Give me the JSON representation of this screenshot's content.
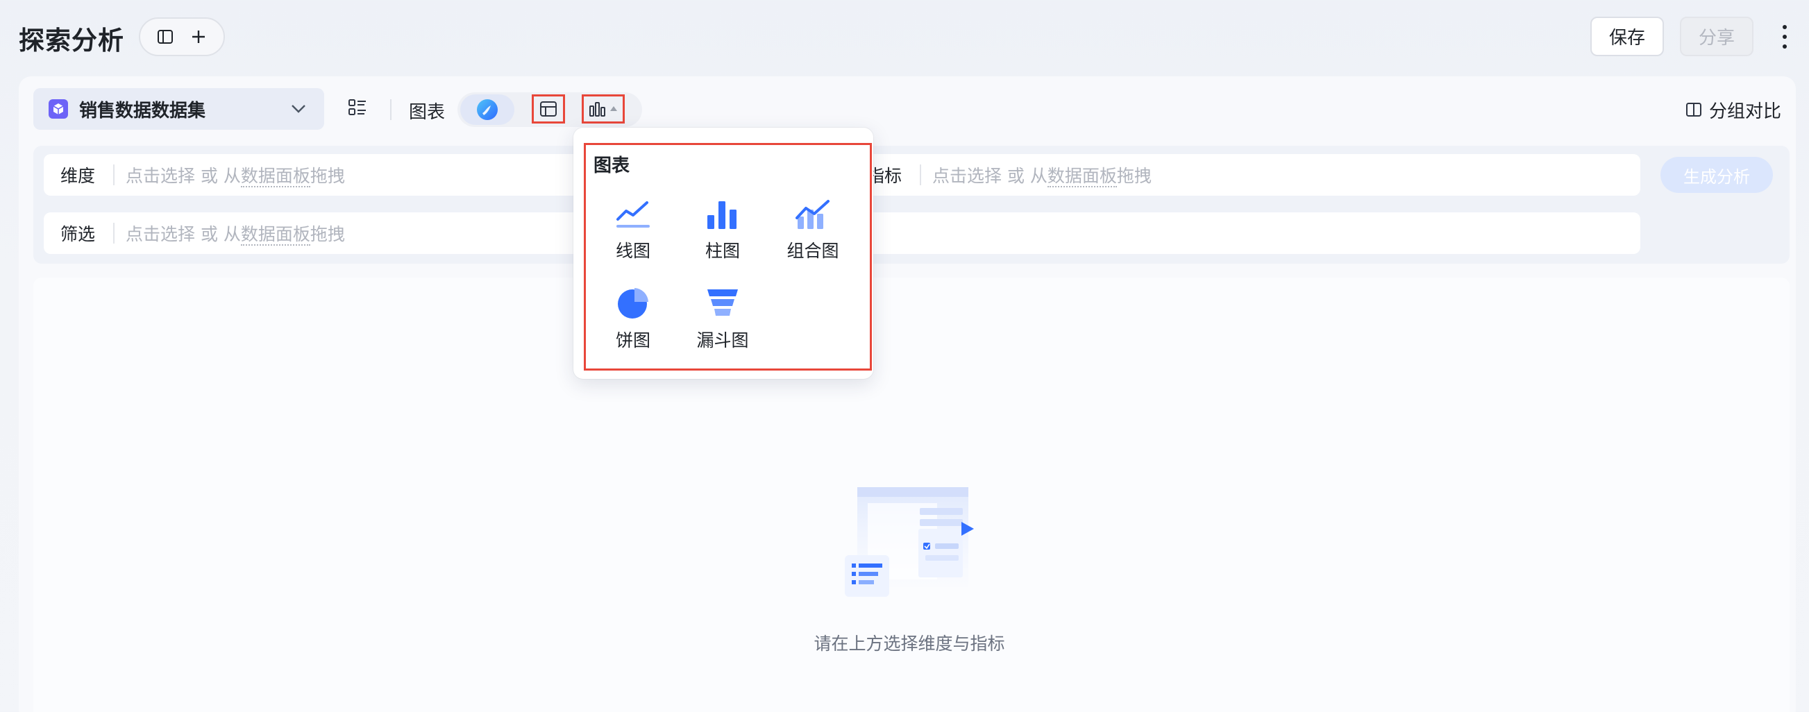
{
  "header": {
    "title": "探索分析",
    "save_label": "保存",
    "share_label": "分享"
  },
  "toolbar": {
    "dataset": "销售数据数据集",
    "chart_label": "图表",
    "group_compare": "分组对比"
  },
  "query": {
    "dimension_label": "维度",
    "metric_label": "指标",
    "filter_label": "筛选",
    "placeholder_prefix": "点击选择 或 从",
    "placeholder_link": "数据面板",
    "placeholder_suffix": "拖拽",
    "generate_label": "生成分析"
  },
  "empty_state": {
    "text": "请在上方选择维度与指标"
  },
  "chart_menu": {
    "title": "图表",
    "options": [
      {
        "label": "线图",
        "icon": "line-chart-icon"
      },
      {
        "label": "柱图",
        "icon": "bar-chart-icon"
      },
      {
        "label": "组合图",
        "icon": "combo-chart-icon"
      },
      {
        "label": "饼图",
        "icon": "pie-chart-icon"
      },
      {
        "label": "漏斗图",
        "icon": "funnel-chart-icon"
      }
    ]
  },
  "colors": {
    "accent": "#3370ff",
    "highlight": "#e8473a",
    "dataset_icon": "#6d63f7"
  }
}
